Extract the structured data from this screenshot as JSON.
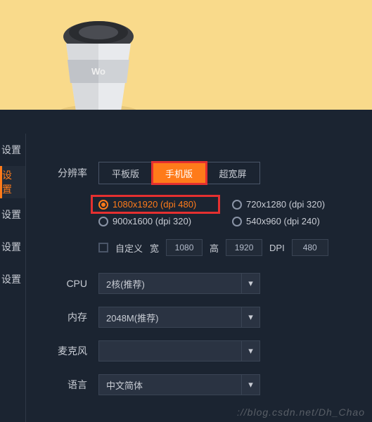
{
  "sidebar": {
    "items": [
      {
        "label": "设置",
        "active": false
      },
      {
        "label": "设置",
        "active": true
      },
      {
        "label": "设置",
        "active": false
      },
      {
        "label": "设置",
        "active": false
      },
      {
        "label": "设置",
        "active": false
      }
    ]
  },
  "resolution": {
    "label": "分辨率",
    "tabs": [
      {
        "label": "平板版",
        "active": false
      },
      {
        "label": "手机版",
        "active": true
      },
      {
        "label": "超宽屏",
        "active": false
      }
    ],
    "options": [
      {
        "label": "1080x1920 (dpi 480)",
        "active": true
      },
      {
        "label": "720x1280 (dpi 320)",
        "active": false
      },
      {
        "label": "900x1600 (dpi 320)",
        "active": false
      },
      {
        "label": "540x960 (dpi 240)",
        "active": false
      }
    ]
  },
  "custom": {
    "label": "自定义",
    "width_label": "宽",
    "width_value": "1080",
    "height_label": "高",
    "height_value": "1920",
    "dpi_label": "DPI",
    "dpi_value": "480"
  },
  "cpu": {
    "label": "CPU",
    "value": "2核(推荐)"
  },
  "memory": {
    "label": "内存",
    "value": "2048M(推荐)"
  },
  "mic": {
    "label": "麦克风",
    "value": ""
  },
  "language": {
    "label": "语言",
    "value": "中文简体"
  },
  "watermark": "://blog.csdn.net/Dh_Chao"
}
